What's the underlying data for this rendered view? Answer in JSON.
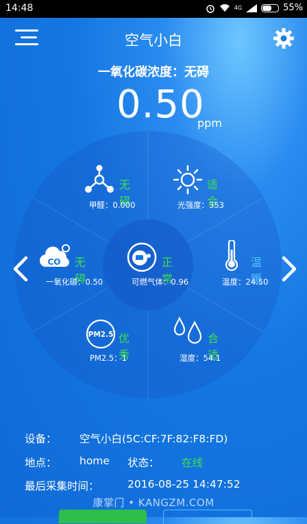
{
  "status_bar": {
    "time": "14:48",
    "network": "4G",
    "battery_text": "55%"
  },
  "app": {
    "title": "空气小白"
  },
  "headline": "一氧化碳浓度：无碍",
  "reading": {
    "value": "0.50",
    "unit": "ppm"
  },
  "sensors": {
    "formaldehyde": {
      "status": "无碍",
      "label": "甲醛：0.000",
      "icon": "molecule-icon"
    },
    "light": {
      "status": "适合",
      "label": "光强度：353",
      "icon": "sun-icon"
    },
    "co": {
      "status": "无碍",
      "label": "一氧化碳：0.50",
      "icon": "co-cloud-icon"
    },
    "gas": {
      "status": "正常",
      "label": "可燃气体：0.96",
      "icon": "gas-meter-icon"
    },
    "temperature": {
      "status": "温暖",
      "label": "温度：24.50",
      "icon": "thermometer-icon"
    },
    "pm25": {
      "status": "优秀",
      "label": "PM2.5：1",
      "icon": "pm25-icon",
      "badge": "PM2.5"
    },
    "humidity": {
      "status": "合适",
      "label": "湿度：54.1",
      "icon": "water-drops-icon"
    }
  },
  "device": {
    "device_label": "设备：",
    "device_value": "空气小白(5C:CF:7F:82:F8:FD)",
    "location_label": "地点：",
    "location_value": "home",
    "state_label": "状态：",
    "state_value": "在线",
    "last_label": "最后采集时间：",
    "last_value": "2016-08-25 14:47:52"
  },
  "watermark": "康掌门 • KANGZM.COM",
  "colors": {
    "status_green": "#3ee04b",
    "status_blue": "#4fc3ff",
    "background": "#1577e2"
  }
}
